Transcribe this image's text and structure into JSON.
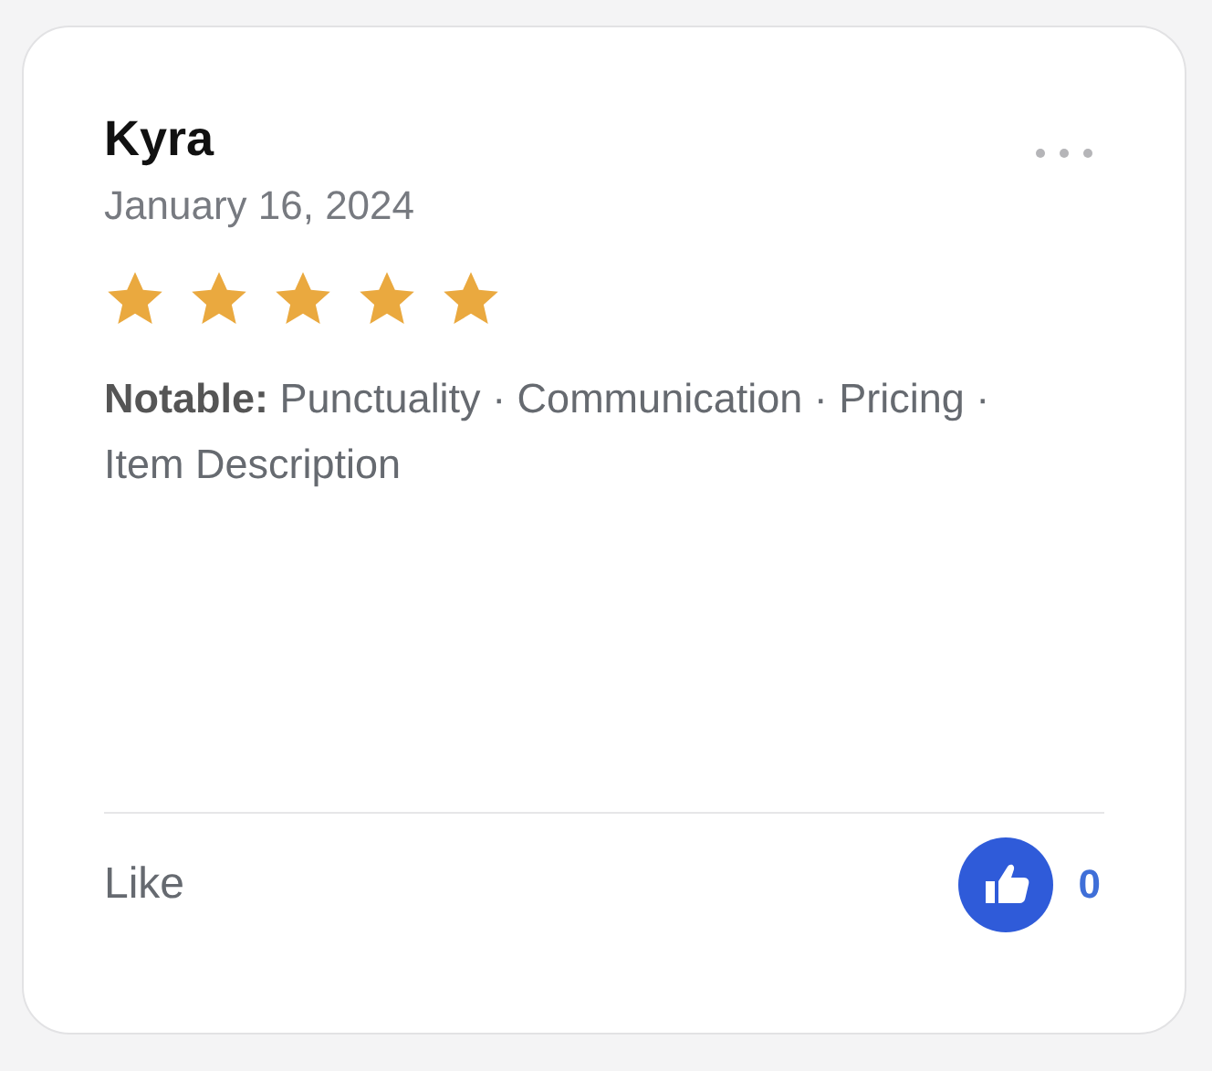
{
  "review": {
    "name": "Kyra",
    "date": "January 16, 2024",
    "stars": 5,
    "notable": "**Notable:** Punctuality · Communication · Pricing · Item Description",
    "like_label": "Like",
    "like_count": "0"
  }
}
